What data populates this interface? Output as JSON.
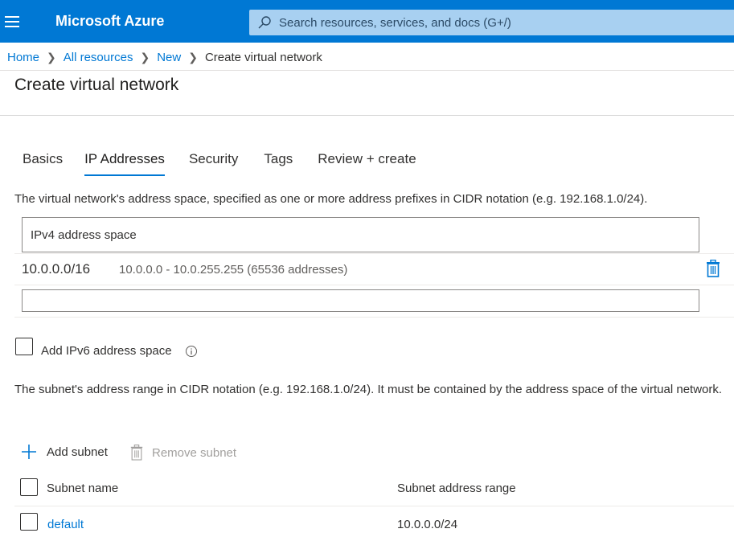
{
  "header": {
    "brand": "Microsoft Azure",
    "search_placeholder": "Search resources, services, and docs (G+/)"
  },
  "breadcrumb": {
    "items": [
      "Home",
      "All resources",
      "New"
    ],
    "current": "Create virtual network"
  },
  "page": {
    "title": "Create virtual network"
  },
  "tabs": [
    {
      "label": "Basics",
      "active": false
    },
    {
      "label": "IP Addresses",
      "active": true
    },
    {
      "label": "Security",
      "active": false
    },
    {
      "label": "Tags",
      "active": false
    },
    {
      "label": "Review + create",
      "active": false
    }
  ],
  "ip": {
    "description": "The virtual network's address space, specified as one or more address prefixes in CIDR notation (e.g. 192.168.1.0/24).",
    "ipv4_header": "IPv4 address space",
    "address": "10.0.0.0/16",
    "address_range": "10.0.0.0 - 10.0.255.255 (65536 addresses)",
    "new_address_value": "",
    "ipv6_label": "Add IPv6 address space",
    "ipv6_checked": false
  },
  "subnets": {
    "description": "The subnet's address range in CIDR notation (e.g. 192.168.1.0/24). It must be contained by the address space of the virtual network.",
    "add_label": "Add subnet",
    "remove_label": "Remove subnet",
    "col_name": "Subnet name",
    "col_range": "Subnet address range",
    "rows": [
      {
        "name": "default",
        "range": "10.0.0.0/24"
      }
    ]
  },
  "colors": {
    "accent": "#0078d4",
    "topbar": "#0078d4",
    "search_bg": "#a8d0f1",
    "disabled": "#a19f9d"
  },
  "icons": {
    "menu": "hamburger-icon",
    "search": "search-icon",
    "chevron": "chevron-right-icon",
    "delete": "trash-icon",
    "info": "info-icon",
    "add": "plus-icon"
  }
}
